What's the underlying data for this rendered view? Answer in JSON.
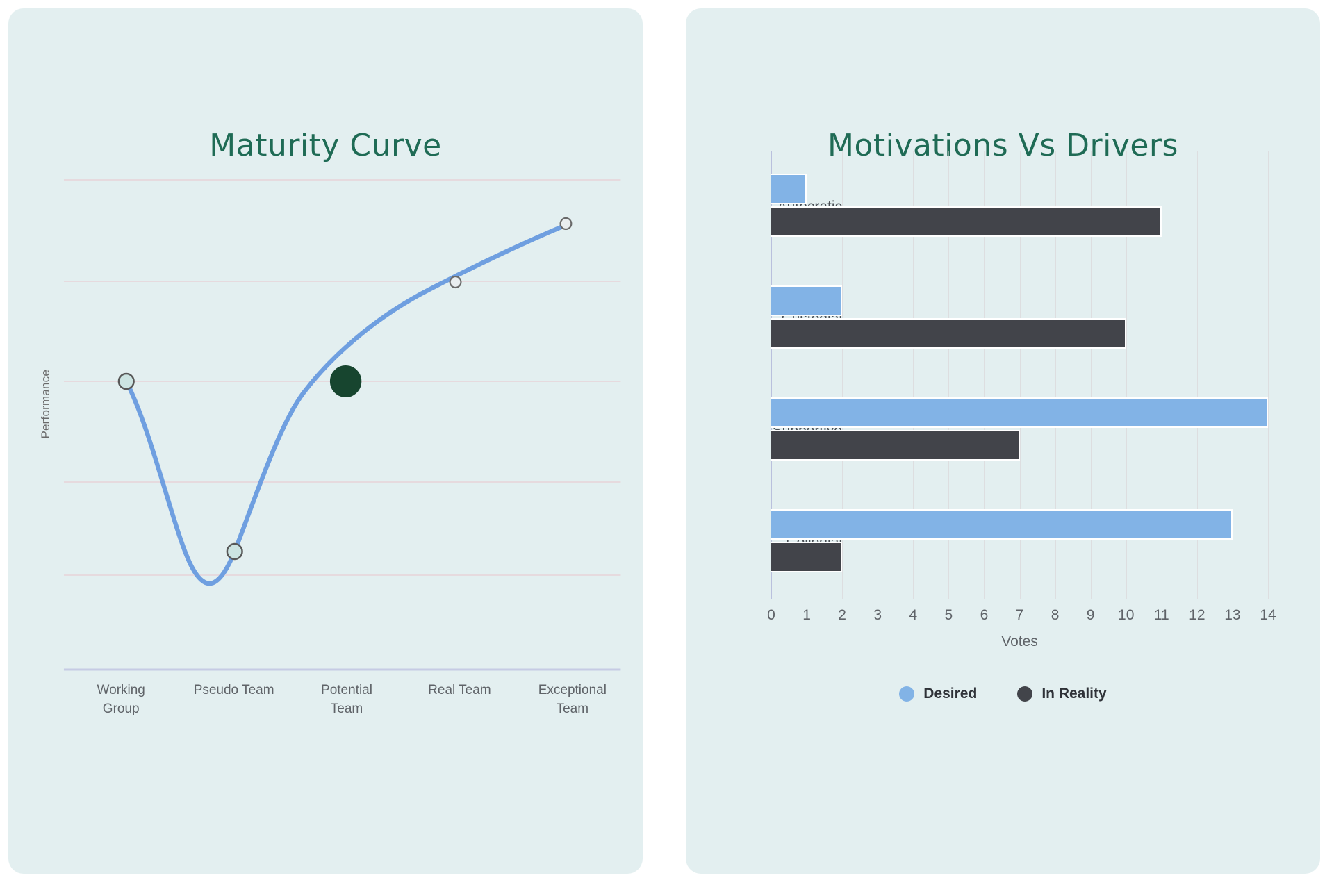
{
  "theme": {
    "page_bg": "#ffffff",
    "card_bg": "#e3eff0",
    "title_color": "#1f6b55",
    "line_color": "#6f9fe0",
    "marker_fill": "#cce4e2",
    "marker_fill_pale": "#e9eef0",
    "marker_stroke": "#585858",
    "highlight_marker": "#17452f",
    "desired_color": "#82b3e6",
    "reality_color": "#42444a",
    "grid_color": "#ded2d8",
    "axis_color": "#c6cbe4",
    "tick_text": "#5f6368"
  },
  "left_card": {
    "title": "Maturity Curve"
  },
  "right_card": {
    "title": "Motivations Vs Drivers"
  },
  "chart_data": [
    {
      "type": "line",
      "title": "Maturity Curve",
      "xlabel": "",
      "ylabel": "Performance",
      "categories": [
        "Working Group",
        "Pseudo Team",
        "Potential Team",
        "Real Team",
        "Exceptional Team"
      ],
      "category_lines": [
        [
          "Working",
          "Group"
        ],
        [
          "Pseudo Team"
        ],
        [
          "Potential",
          "Team"
        ],
        [
          "Real Team"
        ],
        [
          "Exceptional",
          "Team"
        ]
      ],
      "values": [
        62,
        22,
        62,
        80,
        94
      ],
      "ylim": [
        0,
        110
      ],
      "grid": "horizontal",
      "legend": "none",
      "highlighted_point_index": 2,
      "highlighted_point_label": "Potential Team",
      "marker_style": "circle-outline",
      "axis_tick_labels_y": []
    },
    {
      "type": "bar",
      "orientation": "horizontal",
      "title": "Motivations Vs Drivers",
      "xlabel": "Votes",
      "ylabel": "",
      "categories": [
        "Autocratic",
        "Custodial",
        "Supportive",
        "Collegial"
      ],
      "series": [
        {
          "name": "Desired",
          "color": "#82b3e6",
          "values": [
            1,
            2,
            14,
            13
          ]
        },
        {
          "name": "In Reality",
          "color": "#42444a",
          "values": [
            11,
            10,
            7,
            2
          ]
        }
      ],
      "xlim": [
        0,
        14
      ],
      "xticks": [
        0,
        1,
        2,
        3,
        4,
        5,
        6,
        7,
        8,
        9,
        10,
        11,
        12,
        13,
        14
      ],
      "grid": "vertical",
      "legend_position": "bottom-center"
    }
  ]
}
